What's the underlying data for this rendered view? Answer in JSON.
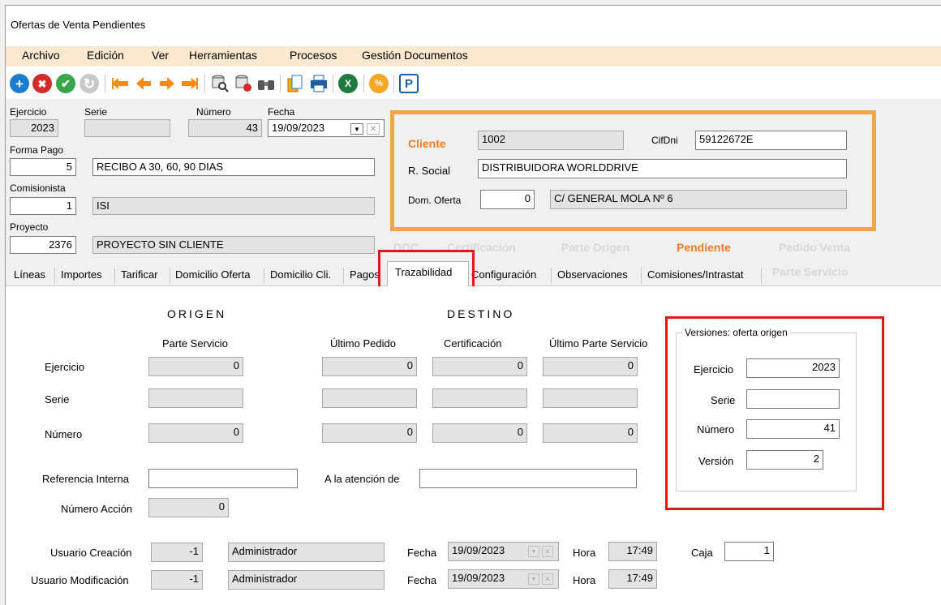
{
  "window": {
    "title": "Ofertas de Venta Pendientes"
  },
  "menu": [
    "Archivo",
    "Edición",
    "Ver",
    "Herramientas",
    "Procesos",
    "Gestión Documentos"
  ],
  "toolbar": {
    "icons": [
      "add-icon",
      "delete-icon",
      "confirm-icon",
      "refresh-icon",
      "first-icon",
      "previous-icon",
      "next-icon",
      "last-icon",
      "search-icon",
      "filter-icon",
      "binoculars-icon",
      "copy-icon",
      "print-icon",
      "excel-icon",
      "percent-icon",
      "pdf-icon"
    ],
    "glyphs": {
      "add": "+",
      "delete": "✖",
      "confirm": "✔",
      "refresh": "↻",
      "excel": "X",
      "percent": "%",
      "pdf": "P"
    }
  },
  "header": {
    "ejercicio_label": "Ejercicio",
    "ejercicio": "2023",
    "serie_label": "Serie",
    "serie": "",
    "numero_label": "Número",
    "numero": "43",
    "fecha_label": "Fecha",
    "fecha": "19/09/2023",
    "forma_pago_label": "Forma Pago",
    "forma_pago_code": "5",
    "forma_pago_desc": "RECIBO A 30, 60, 90 DIAS",
    "comisionista_label": "Comisionista",
    "comisionista_code": "1",
    "comisionista_desc": "ISI",
    "proyecto_label": "Proyecto",
    "proyecto_code": "2376",
    "proyecto_desc": "PROYECTO SIN CLIENTE"
  },
  "cliente": {
    "label": "Cliente",
    "code": "1002",
    "cifdni_label": "CifDni",
    "cifdni": "59122672E",
    "rsocial_label": "R. Social",
    "rsocial": "DISTRIBUIDORA  WORLDDRIVE",
    "dom_label": "Dom. Oferta",
    "dom_code": "0",
    "dom_desc": "C/ GENERAL MOLA Nº 6"
  },
  "status_tabs": [
    "DOC",
    "Certificación",
    "Parte Origen",
    "Pendiente",
    "Pedido Venta",
    "Parte Servicio"
  ],
  "tabs": [
    "Líneas",
    "Importes",
    "Tarificar",
    "Domicilio Oferta",
    "Domicilio Cli.",
    "Pagos",
    "Trazabilidad",
    "Configuración",
    "Observaciones",
    "Comisiones/Intrastat"
  ],
  "trazabilidad": {
    "origen": "ORIGEN",
    "destino": "DESTINO",
    "col_parte_servicio": "Parte Servicio",
    "col_ultimo_pedido": "Último Pedido",
    "col_certificacion": "Certificación",
    "col_ultimo_parte": "Último Parte Servicio",
    "row_ejercicio": "Ejercicio",
    "row_serie": "Serie",
    "row_numero": "Número",
    "zero": "0",
    "ref_interna_label": "Referencia Interna",
    "ref_interna": "",
    "atencion_label": "A la atención de",
    "atencion": "",
    "num_accion_label": "Número Acción",
    "num_accion": "0"
  },
  "versiones": {
    "title": "Versiones:  oferta origen",
    "ejercicio_label": "Ejercicio",
    "ejercicio": "2023",
    "serie_label": "Serie",
    "serie": "",
    "numero_label": "Número",
    "numero": "41",
    "version_label": "Versión",
    "version": "2"
  },
  "audit": {
    "creacion_label": "Usuario Creación",
    "creacion_id": "-1",
    "creacion_user": "Administrador",
    "modif_label": "Usuario Modificación",
    "modif_id": "-1",
    "modif_user": "Administrador",
    "fecha_label": "Fecha",
    "fecha1": "19/09/2023",
    "fecha2": "19/09/2023",
    "hora_label": "Hora",
    "hora1": "17:49",
    "hora2": "17:49",
    "caja_label": "Caja",
    "caja": "1"
  },
  "colors": {
    "menubar": "#fbe8cf",
    "cliente_orange": "#f07a22",
    "highlight_box": "#e01818",
    "cliente_box": "#f4a545"
  }
}
